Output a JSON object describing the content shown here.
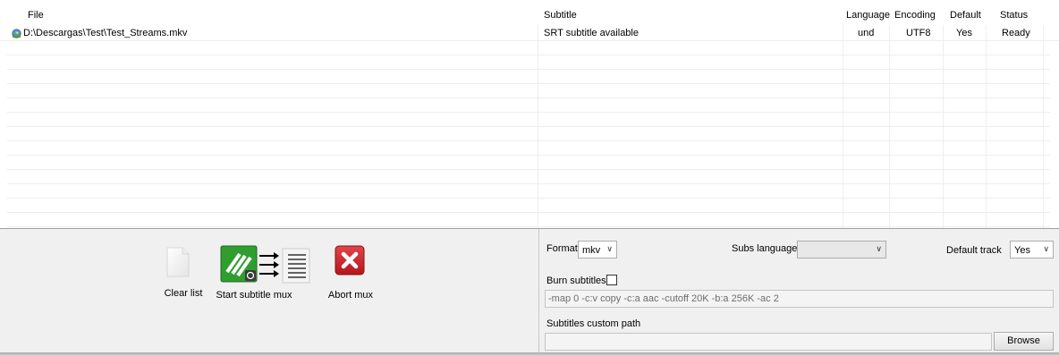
{
  "columns": {
    "file": "File",
    "subtitle": "Subtitle",
    "language": "Language",
    "encoding": "Encoding",
    "default": "Default",
    "status": "Status"
  },
  "rows": [
    {
      "file": "D:\\Descargas\\Test\\Test_Streams.mkv",
      "subtitle": "SRT subtitle available",
      "language": "und",
      "encoding": "UTF8",
      "default": "Yes",
      "status": "Ready"
    }
  ],
  "icons": {
    "file_icon": "media-file-icon",
    "clear_icon": "blank-document-icon",
    "mux_icon": "ffmpeg-mux-icon",
    "abort_icon": "red-x-icon"
  },
  "toolbar": {
    "clear_label": "Clear list",
    "start_label": "Start subtitle mux",
    "abort_label": "Abort mux"
  },
  "options": {
    "format_label": "Format",
    "format_value": "mkv",
    "subs_language_label": "Subs language",
    "subs_language_value": "",
    "default_track_label": "Default track",
    "default_track_value": "Yes",
    "burn_label": "Burn subtitles",
    "burn_checked": false,
    "ffmpeg_args": "-map 0 -c:v copy -c:a aac -cutoff 20K -b:a 256K -ac 2",
    "custom_path_label": "Subtitles custom path",
    "custom_path_value": "",
    "browse_label": "Browse"
  },
  "colors": {
    "abort_red": "#c8232a",
    "ffmpeg_green": "#2f9e2f",
    "panel_bg": "#f0f0f0"
  }
}
